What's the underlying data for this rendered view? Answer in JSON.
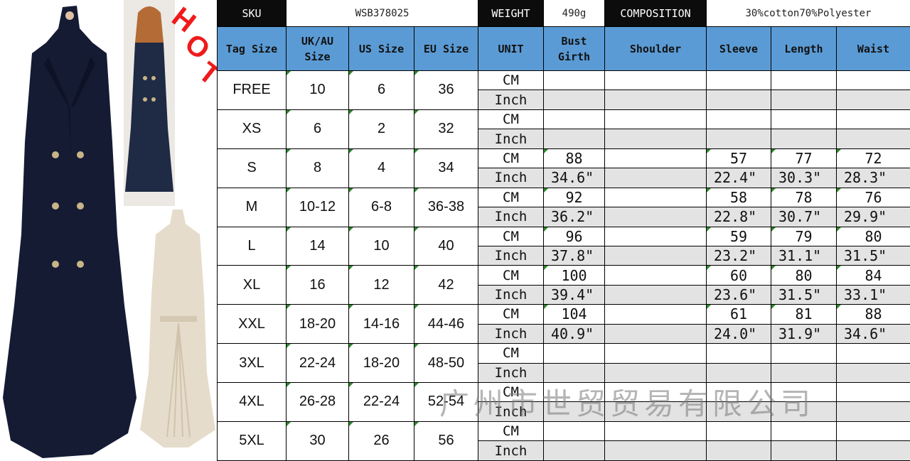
{
  "hot_badge": "HOT",
  "header": {
    "sku_label": "SKU",
    "sku_value": "WSB378025",
    "weight_label": "WEIGHT",
    "weight_value": "490g",
    "composition_label": "COMPOSITION",
    "composition_value": "30%cotton70%Polyester"
  },
  "columns": {
    "tag_size": "Tag Size",
    "uk_au_size": "UK/AU Size",
    "us_size": "US Size",
    "eu_size": "EU Size",
    "unit": "UNIT",
    "bust_girth": "Bust Girth",
    "shoulder": "Shoulder",
    "sleeve": "Sleeve",
    "length": "Length",
    "waist": "Waist"
  },
  "units": {
    "cm": "CM",
    "inch": "Inch"
  },
  "rows": [
    {
      "tag": "FREE",
      "uk": "10",
      "us": "6",
      "eu": "36",
      "cm": {
        "bust": "",
        "shoulder": "",
        "sleeve": "",
        "length": "",
        "waist": ""
      },
      "inch": {
        "bust": "",
        "shoulder": "",
        "sleeve": "",
        "length": "",
        "waist": ""
      }
    },
    {
      "tag": "XS",
      "uk": "6",
      "us": "2",
      "eu": "32",
      "cm": {
        "bust": "",
        "shoulder": "",
        "sleeve": "",
        "length": "",
        "waist": ""
      },
      "inch": {
        "bust": "",
        "shoulder": "",
        "sleeve": "",
        "length": "",
        "waist": ""
      }
    },
    {
      "tag": "S",
      "uk": "8",
      "us": "4",
      "eu": "34",
      "cm": {
        "bust": "88",
        "shoulder": "",
        "sleeve": "57",
        "length": "77",
        "waist": "72"
      },
      "inch": {
        "bust": "34.6\"",
        "shoulder": "",
        "sleeve": "22.4\"",
        "length": "30.3\"",
        "waist": "28.3\""
      }
    },
    {
      "tag": "M",
      "uk": "10-12",
      "us": "6-8",
      "eu": "36-38",
      "cm": {
        "bust": "92",
        "shoulder": "",
        "sleeve": "58",
        "length": "78",
        "waist": "76"
      },
      "inch": {
        "bust": "36.2\"",
        "shoulder": "",
        "sleeve": "22.8\"",
        "length": "30.7\"",
        "waist": "29.9\""
      }
    },
    {
      "tag": "L",
      "uk": "14",
      "us": "10",
      "eu": "40",
      "cm": {
        "bust": "96",
        "shoulder": "",
        "sleeve": "59",
        "length": "79",
        "waist": "80"
      },
      "inch": {
        "bust": "37.8\"",
        "shoulder": "",
        "sleeve": "23.2\"",
        "length": "31.1\"",
        "waist": "31.5\""
      }
    },
    {
      "tag": "XL",
      "uk": "16",
      "us": "12",
      "eu": "42",
      "cm": {
        "bust": "100",
        "shoulder": "",
        "sleeve": "60",
        "length": "80",
        "waist": "84"
      },
      "inch": {
        "bust": "39.4\"",
        "shoulder": "",
        "sleeve": "23.6\"",
        "length": "31.5\"",
        "waist": "33.1\""
      }
    },
    {
      "tag": "XXL",
      "uk": "18-20",
      "us": "14-16",
      "eu": "44-46",
      "cm": {
        "bust": "104",
        "shoulder": "",
        "sleeve": "61",
        "length": "81",
        "waist": "88"
      },
      "inch": {
        "bust": "40.9\"",
        "shoulder": "",
        "sleeve": "24.0\"",
        "length": "31.9\"",
        "waist": "34.6\""
      }
    },
    {
      "tag": "3XL",
      "uk": "22-24",
      "us": "18-20",
      "eu": "48-50",
      "cm": {
        "bust": "",
        "shoulder": "",
        "sleeve": "",
        "length": "",
        "waist": ""
      },
      "inch": {
        "bust": "",
        "shoulder": "",
        "sleeve": "",
        "length": "",
        "waist": ""
      }
    },
    {
      "tag": "4XL",
      "uk": "26-28",
      "us": "22-24",
      "eu": "52-54",
      "cm": {
        "bust": "",
        "shoulder": "",
        "sleeve": "",
        "length": "",
        "waist": ""
      },
      "inch": {
        "bust": "",
        "shoulder": "",
        "sleeve": "",
        "length": "",
        "waist": ""
      }
    },
    {
      "tag": "5XL",
      "uk": "30",
      "us": "26",
      "eu": "56",
      "cm": {
        "bust": "",
        "shoulder": "",
        "sleeve": "",
        "length": "",
        "waist": ""
      },
      "inch": {
        "bust": "",
        "shoulder": "",
        "sleeve": "",
        "length": "",
        "waist": ""
      }
    }
  ],
  "watermark": "广州市世贸贸易有限公司",
  "colors": {
    "header_blue": "#5b9bd5",
    "header_dark": "#0c0c0c",
    "inch_row": "#e3e3e3",
    "hot": "#ee1b1b",
    "navy_coat": "#141b33",
    "beige_coat": "#e6dccb"
  }
}
